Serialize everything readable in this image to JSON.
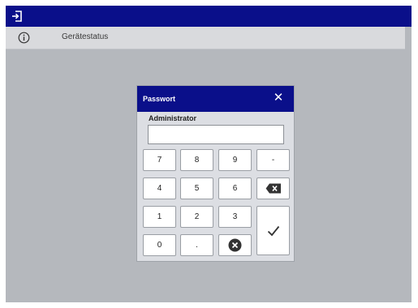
{
  "topbar": {
    "icon": "exit-icon"
  },
  "status_bar": {
    "icon": "info-icon",
    "label": "Gerätestatus"
  },
  "dialog": {
    "title": "Passwort",
    "close_icon": "close-icon",
    "user": "Administrator",
    "password_value": "",
    "keypad": {
      "row1": [
        "7",
        "8",
        "9",
        "-"
      ],
      "row2": [
        "4",
        "5",
        "6"
      ],
      "row3": [
        "1",
        "2",
        "3"
      ],
      "row4": [
        "0",
        "."
      ],
      "backspace_icon": "backspace-icon",
      "clear_icon": "clear-icon",
      "confirm_icon": "checkmark-icon"
    }
  },
  "colors": {
    "header_blue": "#0a0f8a",
    "background_gray": "#b5b8bd",
    "dialog_bg": "#dcdee3",
    "key_bg": "#ffffff"
  }
}
